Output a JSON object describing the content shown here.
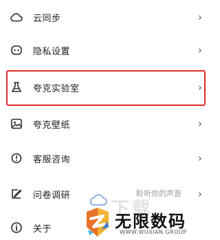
{
  "menu": {
    "items": [
      {
        "label": "云同步",
        "icon": "cloud-icon"
      },
      {
        "label": "隐私设置",
        "icon": "privacy-icon"
      },
      {
        "label": "夸克实验室",
        "icon": "flask-icon"
      },
      {
        "label": "夸克壁纸",
        "icon": "image-icon"
      },
      {
        "label": "客服咨询",
        "icon": "headset-icon"
      },
      {
        "label": "问卷调研",
        "icon": "survey-icon"
      },
      {
        "label": "关于",
        "icon": "info-icon"
      }
    ],
    "chevron": "›",
    "highlighted_item": "夸克实验室"
  },
  "overlay": {
    "listen_text": "聆听你的声音",
    "watermark_faint": "下载",
    "watermark_title": "无限数码",
    "watermark_url": "WWW.WUXIAN.GROUP"
  },
  "colors": {
    "highlight_border": "#e02b2b",
    "text": "#1e1e1e",
    "icon": "#2a2a2a"
  }
}
